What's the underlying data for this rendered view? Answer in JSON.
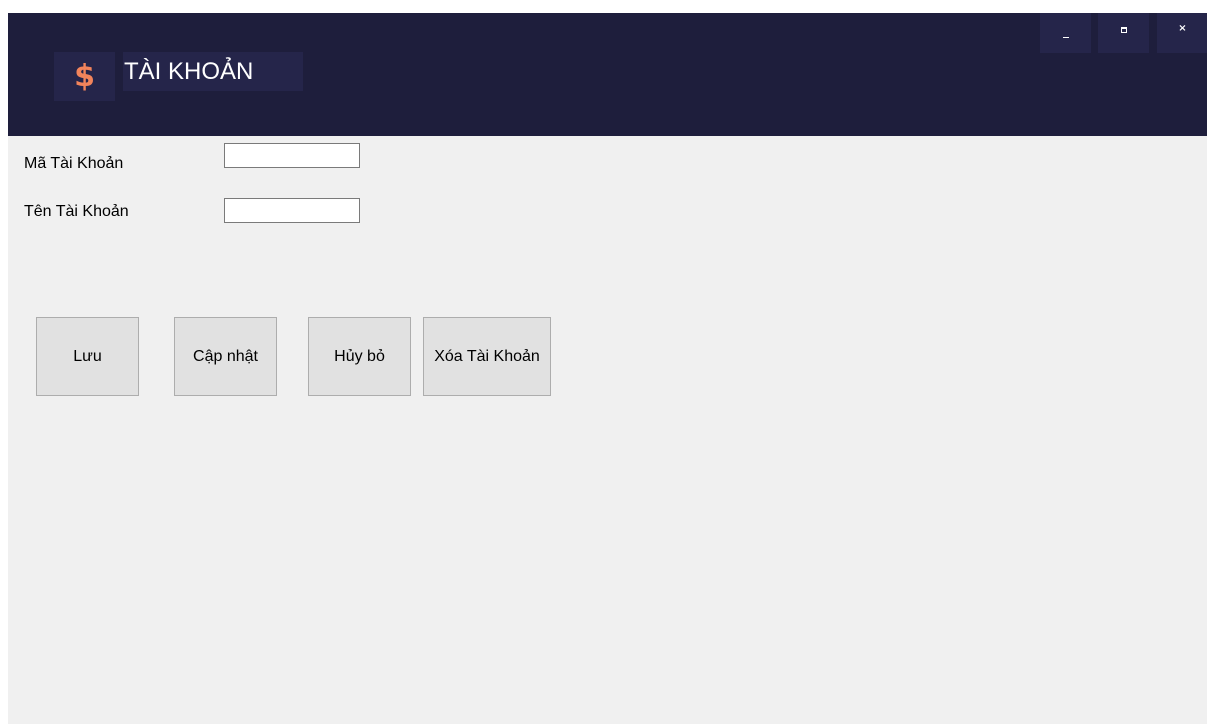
{
  "header": {
    "logo_symbol": "$",
    "title": "TÀI KHOẢN",
    "background_color": "#1e1e3c",
    "accent_color": "#f2845b"
  },
  "window_controls": {
    "minimize_icon": "minimize-icon",
    "maximize_icon": "maximize-icon",
    "close_icon": "close-icon",
    "close_glyph": "×"
  },
  "form": {
    "ma_tai_khoan": {
      "label": "Mã Tài Khoản",
      "value": ""
    },
    "ten_tai_khoan": {
      "label": "Tên Tài Khoản",
      "value": ""
    }
  },
  "buttons": {
    "luu": "Lưu",
    "cap_nhat": "Cập nhật",
    "huy_bo": "Hủy bỏ",
    "xoa_tai_khoan": "Xóa Tài Khoản"
  }
}
